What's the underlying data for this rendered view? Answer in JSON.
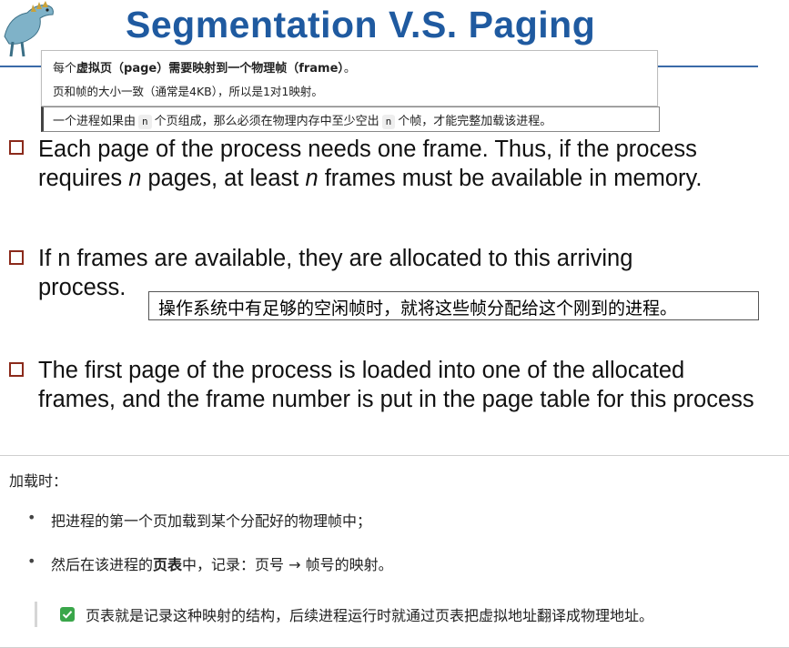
{
  "title": "Segmentation V.S. Paging",
  "note_top": {
    "line1_prefix": "每个",
    "line1_bold": "虚拟页（page）需要映射到一个物理帧（frame）",
    "line1_suffix": "。",
    "line2": "页和帧的大小一致（通常是4KB），所以是1对1映射。"
  },
  "note_n": {
    "part1": "一个进程如果由",
    "code1": "n",
    "part2": "个页组成，那么必须在物理内存中至少空出",
    "code2": "n",
    "part3": "个帧，才能完整加载该进程。"
  },
  "bullets": {
    "b1_a": "Each page of the process needs one frame. Thus, if the process requires ",
    "b1_n1": "n",
    "b1_b": " pages, at least ",
    "b1_n2": "n",
    "b1_c": " frames must be available in memory.",
    "b2_line1": "If n frames are available, they are allocated to this arriving",
    "b2_line2": "process.",
    "b3": "The first page of the process is loaded into one of the allocated frames, and the frame number is put in the page table for this process"
  },
  "note_os": "操作系统中有足够的空闲帧时，就将这些帧分配给这个刚到的进程。",
  "panel": {
    "heading": "加载时：",
    "item1": "把进程的第一个页加载到某个分配好的物理帧中；",
    "item2_a": "然后在该进程的",
    "item2_bold": "页表",
    "item2_b": "中，记录：页号 → 帧号的映射。",
    "tip": "页表就是记录这种映射的结构，后续进程运行时就通过页表把虚拟地址翻译成物理地址。",
    "bullet_glyph": "•"
  },
  "colors": {
    "title": "#1f5aa0",
    "bullet_box": "#8b2a1b",
    "check": "#3aa64a"
  }
}
